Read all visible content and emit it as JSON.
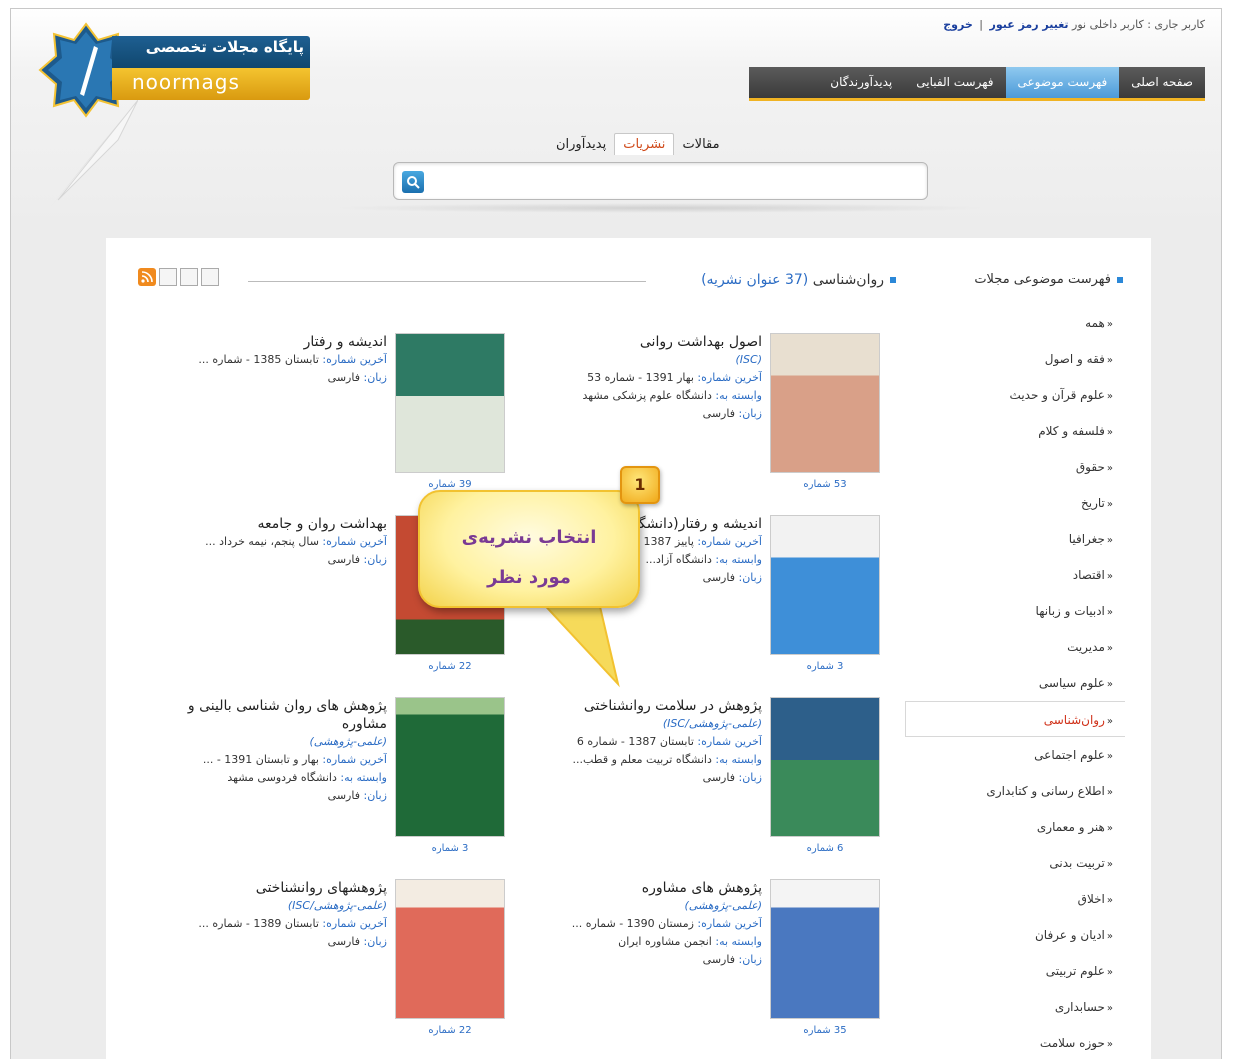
{
  "userbar": {
    "current_user": "کاربر جاری : کاربر داخلی نور",
    "change_password": "تغییر رمز عبور",
    "divider": "|",
    "logout": "خروج"
  },
  "logo": {
    "title": "پایگاه مجلات تخصصی",
    "subtitle": "noormags"
  },
  "mainnav": [
    {
      "label": "صفحه اصلی"
    },
    {
      "label": "فهرست موضوعی"
    },
    {
      "label": "فهرست الفبایی"
    },
    {
      "label": "پدیدآورندگان"
    }
  ],
  "search": {
    "tabs": [
      "مقالات",
      "نشریات",
      "پدیدآوران"
    ],
    "value": ""
  },
  "sidebar": {
    "title": "فهرست موضوعی مجلات",
    "items": [
      "همه",
      "فقه و اصول",
      "علوم قرآن و حدیث",
      "فلسفه و کلام",
      "حقوق",
      "تاریخ",
      "جغرافیا",
      "اقتصاد",
      "ادبیات و زبانها",
      "مدیریت",
      "علوم سیاسی",
      "روان‌شناسی",
      "علوم اجتماعی",
      "اطلاع رسانی و کتابداری",
      "هنر و معماری",
      "تربیت بدنی",
      "اخلاق",
      "ادیان و عرفان",
      "علوم تربیتی",
      "حسابداری",
      "حوزه سلامت"
    ]
  },
  "section": {
    "title": "روان‌شناسی",
    "count_text": "(37 عنوان نشریه)"
  },
  "labels": {
    "last_issue": "آخرین شماره:",
    "affiliated": "وابسته به:",
    "language": "زبان:"
  },
  "cards": [
    {
      "title": "اصول بهداشت روانی",
      "badge": "(ISC)",
      "last_issue": "بهار 1391 - شماره 53",
      "affiliated": "دانشگاه علوم پزشکی مشهد",
      "language": "فارسی",
      "count": "53 شماره",
      "cover_color": "#d9a088"
    },
    {
      "title": "اندیشه و رفتار",
      "badge": "",
      "last_issue": "تابستان 1385 - شماره ...",
      "affiliated": "",
      "language": "فارسی",
      "count": "39 شماره",
      "cover_color": "#2e7a64"
    },
    {
      "title": "اندیشه و رفتار(دانشگاه آزاد رودهن)",
      "badge": "",
      "last_issue": "پاییز 1387",
      "affiliated": "دانشگاه آزاد...",
      "language": "فارسی",
      "count": "3 شماره",
      "cover_color": "#3e8fd8"
    },
    {
      "title": "بهداشت روان و جامعه",
      "badge": "",
      "last_issue": "سال پنجم، نیمه خرداد ...",
      "affiliated": "",
      "language": "فارسی",
      "count": "22 شماره",
      "cover_color": "#c44a32"
    },
    {
      "title": "پژوهش در سلامت روانشناختی",
      "badge": "(علمی-پژوهشی/ISC)",
      "last_issue": "تابستان 1387 - شماره 6",
      "affiliated": "دانشگاه تربیت معلم و قطب...",
      "language": "فارسی",
      "count": "6 شماره",
      "cover_color": "#3a8a5a"
    },
    {
      "title": "پژوهش های روان شناسی بالینی و مشاوره",
      "badge": "(علمی-پژوهشی)",
      "last_issue": "بهار و تابستان 1391 - ...",
      "affiliated": "دانشگاه فردوسی مشهد",
      "language": "فارسی",
      "count": "3 شماره",
      "cover_color": "#1f6a38"
    },
    {
      "title": "پژوهش های مشاوره",
      "badge": "(علمی-پژوهشی)",
      "last_issue": "زمستان 1390 - شماره ...",
      "affiliated": "انجمن مشاوره ایران",
      "language": "فارسی",
      "count": "35 شماره",
      "cover_color": "#4a78c0"
    },
    {
      "title": "پژوهشهای روانشناختی",
      "badge": "(علمی-پژوهشی/ISC)",
      "last_issue": "تابستان 1389 - شماره ...",
      "affiliated": "",
      "language": "فارسی",
      "count": "22 شماره",
      "cover_color": "#e06a5a"
    }
  ],
  "callout": {
    "number": "1",
    "line1": "انتخاب نشریه‌ی",
    "line2": "مورد نظر"
  }
}
